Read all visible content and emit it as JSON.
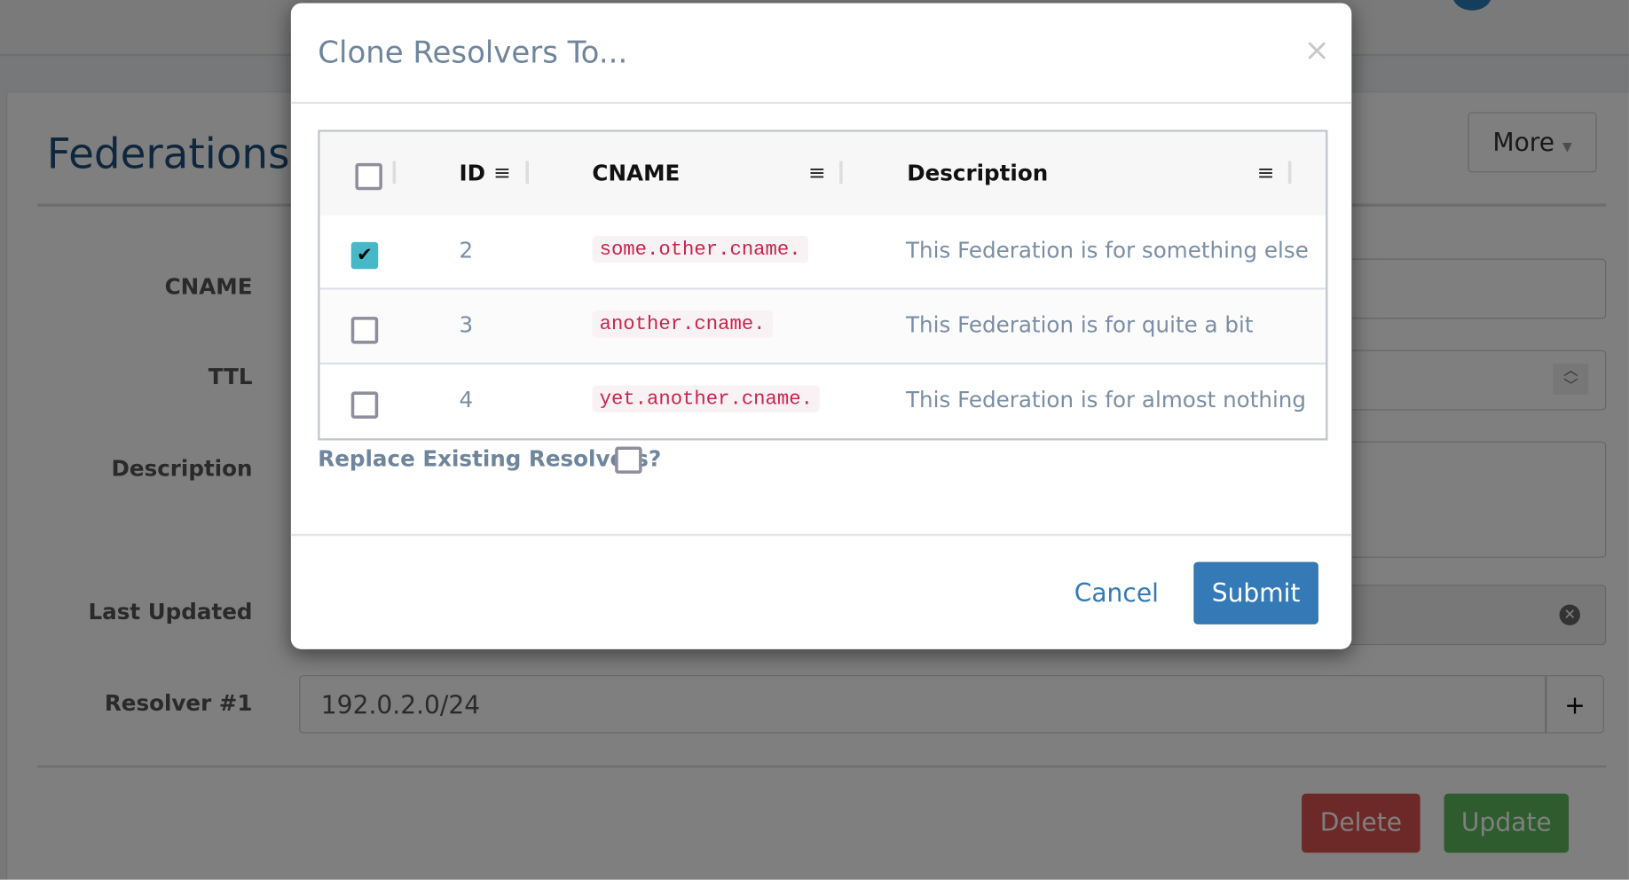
{
  "page": {
    "title": "Federations",
    "more_label": "More",
    "fields": [
      {
        "label": "CNAME",
        "value": ""
      },
      {
        "label": "TTL",
        "value": ""
      },
      {
        "label": "Description",
        "value": ""
      },
      {
        "label": "Last Updated",
        "value": ""
      },
      {
        "label": "Resolver #1",
        "value": "192.0.2.0/24"
      }
    ],
    "add_label": "+",
    "delete_label": "Delete",
    "update_label": "Update"
  },
  "modal": {
    "title": "Clone Resolvers To...",
    "close": "×",
    "columns": [
      "ID",
      "CNAME",
      "Description"
    ],
    "rows": [
      {
        "id": "2",
        "cname": "some.other.cname.",
        "description": "This Federation is for something else",
        "checked": true
      },
      {
        "id": "3",
        "cname": "another.cname.",
        "description": "This Federation is for quite a bit",
        "checked": false
      },
      {
        "id": "4",
        "cname": "yet.another.cname.",
        "description": "This Federation is for almost nothing",
        "checked": false
      }
    ],
    "replace_label": "Replace Existing Resolvers?",
    "cancel_label": "Cancel",
    "submit_label": "Submit"
  },
  "colors": {
    "primary": "#337ab7",
    "check": "#46b8c8",
    "danger": "#d9534f",
    "success": "#5cb85c"
  }
}
